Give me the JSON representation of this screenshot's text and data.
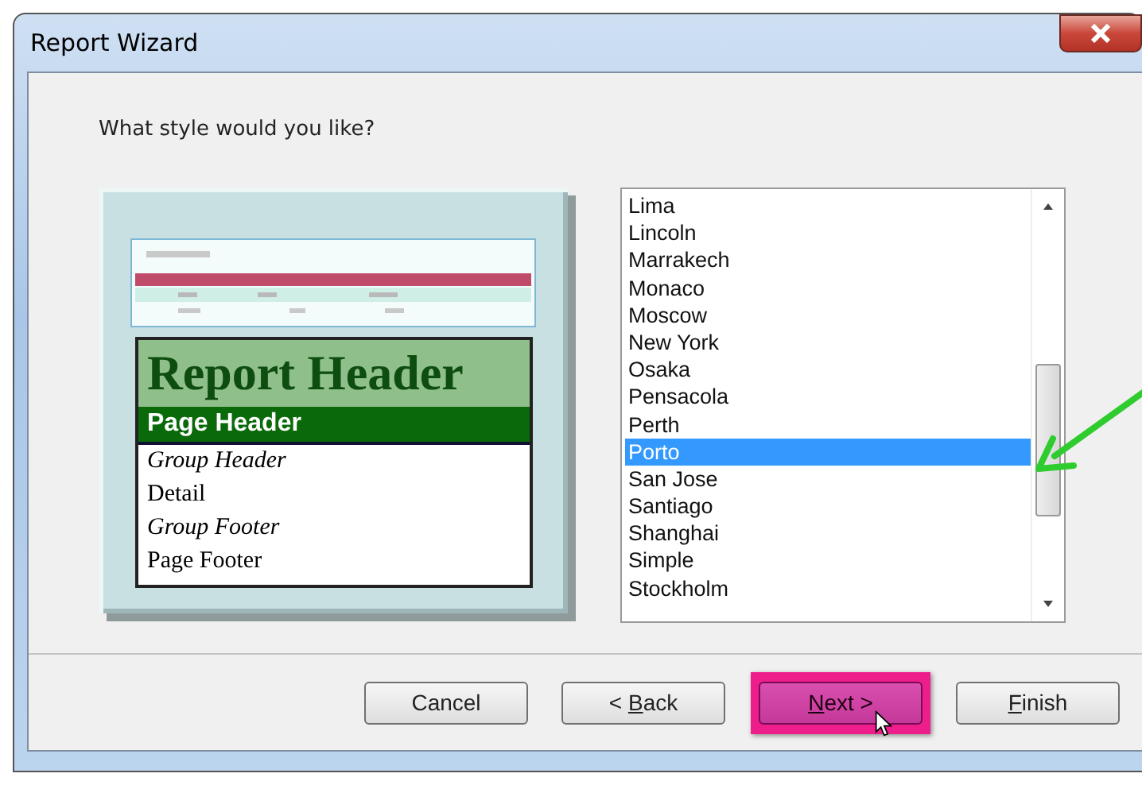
{
  "window": {
    "title": "Report Wizard"
  },
  "prompt": "What style would you like?",
  "preview": {
    "sections": [
      {
        "label": "Report Header",
        "kind": "report-header"
      },
      {
        "label": "Page Header",
        "kind": "page-header"
      },
      {
        "label": "Group Header",
        "kind": "group"
      },
      {
        "label": "Detail",
        "kind": "detail"
      },
      {
        "label": "Group Footer",
        "kind": "group"
      },
      {
        "label": "Page Footer",
        "kind": "detail"
      }
    ]
  },
  "styles": [
    {
      "label": "Lima",
      "selected": false
    },
    {
      "label": "Lincoln",
      "selected": false
    },
    {
      "label": "Marrakech",
      "selected": false
    },
    {
      "label": "Monaco",
      "selected": false
    },
    {
      "label": "Moscow",
      "selected": false
    },
    {
      "label": "New York",
      "selected": false
    },
    {
      "label": "Osaka",
      "selected": false
    },
    {
      "label": "Pensacola",
      "selected": false
    },
    {
      "label": "Perth",
      "selected": false
    },
    {
      "label": "Porto",
      "selected": true
    },
    {
      "label": "San Jose",
      "selected": false
    },
    {
      "label": "Santiago",
      "selected": false
    },
    {
      "label": "Shanghai",
      "selected": false
    },
    {
      "label": "Simple",
      "selected": false
    },
    {
      "label": "Stockholm",
      "selected": false
    }
  ],
  "buttons": [
    {
      "before": "Cancel",
      "highlighted": false
    },
    {
      "before": "< ",
      "mnemonic": "B",
      "after": "ack",
      "highlighted": false
    },
    {
      "mnemonic": "N",
      "after": "ext >",
      "highlighted": true
    },
    {
      "mnemonic": "F",
      "after": "inish",
      "highlighted": false
    }
  ]
}
